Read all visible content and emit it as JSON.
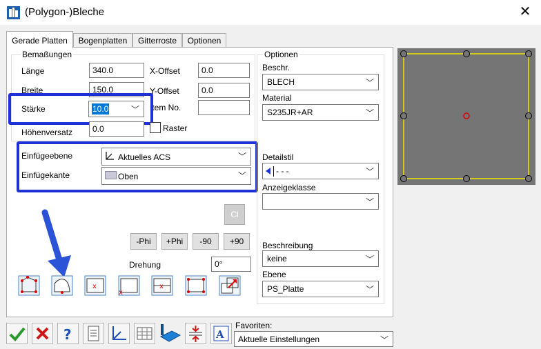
{
  "window": {
    "title": "(Polygon-)Bleche",
    "close_glyph": "✕"
  },
  "tabs": [
    "Gerade Platten",
    "Bogenplatten",
    "Gitterroste",
    "Optionen"
  ],
  "dimensions": {
    "group_label": "Bemaßungen",
    "laenge_label": "Länge",
    "laenge_value": "340.0",
    "breite_label": "Breite",
    "breite_value": "150.0",
    "staerke_label": "Stärke",
    "staerke_value": "10.0",
    "hoehenversatz_label": "Höhenversatz",
    "hoehenversatz_value": "0.0",
    "xoffset_label": "X-Offset",
    "xoffset_value": "0.0",
    "yoffset_label": "Y-Offset",
    "yoffset_value": "0.0",
    "itemno_label": "Item No.",
    "itemno_value": "",
    "raster_label": "Raster",
    "raster_checked": false
  },
  "insertion": {
    "ebene_label": "Einfügeebene",
    "ebene_value": "Aktuelles ACS",
    "kante_label": "Einfügekante",
    "kante_value": "Oben"
  },
  "cl_button": "Cl",
  "rotation": {
    "buttons": [
      "-Phi",
      "+Phi",
      "-90",
      "+90"
    ],
    "drehung_label": "Drehung",
    "drehung_value": "0°"
  },
  "shape_buttons": [
    "polygon-shape-icon",
    "rounded-rect-shape-icon",
    "center-point-icon",
    "corner-point-icon",
    "mid-left-point-icon",
    "four-corners-icon",
    "resize-arrow-icon"
  ],
  "options": {
    "group_label": "Optionen",
    "beschr_label": "Beschr.",
    "beschr_value": "BLECH",
    "material_label": "Material",
    "material_value": "S235JR+AR",
    "detailstil_label": "Detailstil",
    "detailstil_value": "- - -",
    "anzeigeklasse_label": "Anzeigeklasse",
    "anzeigeklasse_value": "",
    "beschreibung_label": "Beschreibung",
    "beschreibung_value": "keine",
    "ebene_label": "Ebene",
    "ebene_value": "PS_Platte"
  },
  "footer": {
    "favoriten_label": "Favoriten:",
    "favoriten_value": "Aktuelle Einstellungen",
    "icons": [
      "ok-check-icon",
      "cancel-x-icon",
      "help-icon",
      "document-icon",
      "axis-icon",
      "grid-icon",
      "3d-plate-icon",
      "thickness-icon",
      "text-format-icon"
    ]
  },
  "colors": {
    "highlight": "#1d31d6",
    "arrow": "#2a53d8",
    "preview_bg": "#757575",
    "outline": "#f0e300",
    "center_marker": "#e00000"
  }
}
